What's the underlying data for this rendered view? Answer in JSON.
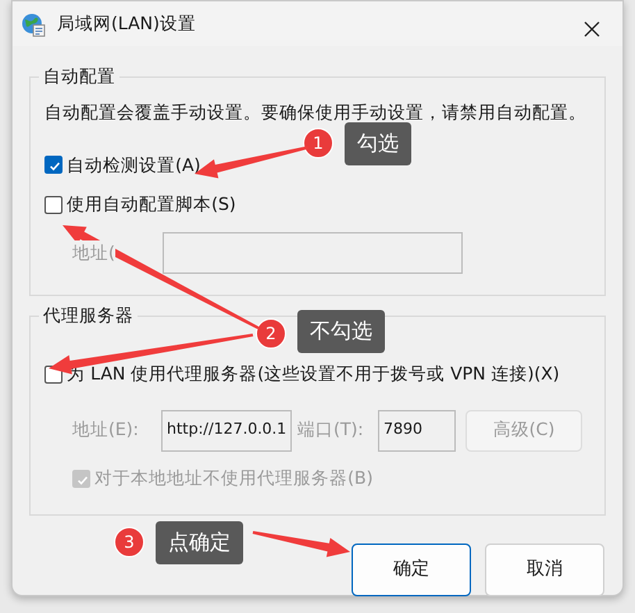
{
  "window": {
    "title": "局域网(LAN)设置"
  },
  "auto_config": {
    "title": "自动配置",
    "description": "自动配置会覆盖手动设置。要确保使用手动设置，请禁用自动配置。",
    "options": [
      {
        "label": "自动检测设置(A)",
        "checked": true
      },
      {
        "label": "使用自动配置脚本(S)",
        "checked": false
      }
    ],
    "address": {
      "label": "地址(",
      "disabled": true
    }
  },
  "proxy": {
    "title": "代理服务器",
    "use_proxy": {
      "label": "为 LAN 使用代理服务器(这些设置不用于拨号或 VPN 连接)(X)",
      "checked": false
    },
    "address": {
      "label": "地址(E):",
      "value": "http://127.0.0.1",
      "disabled": true
    },
    "port": {
      "label": "端口(T):",
      "value": "7890",
      "disabled": true
    },
    "advanced_button": {
      "label": "高级(C)",
      "disabled": true
    },
    "bypass_local": {
      "label": "对于本地地址不使用代理服务器(B)",
      "checked": true,
      "disabled": true
    }
  },
  "buttons": [
    {
      "label": "确定",
      "selected": true
    },
    {
      "label": "取消",
      "selected": false
    }
  ],
  "annotations": [
    {
      "number": "1",
      "text": "勾选"
    },
    {
      "number": "2",
      "text": "不勾选"
    },
    {
      "number": "3",
      "text": "点确定"
    }
  ]
}
